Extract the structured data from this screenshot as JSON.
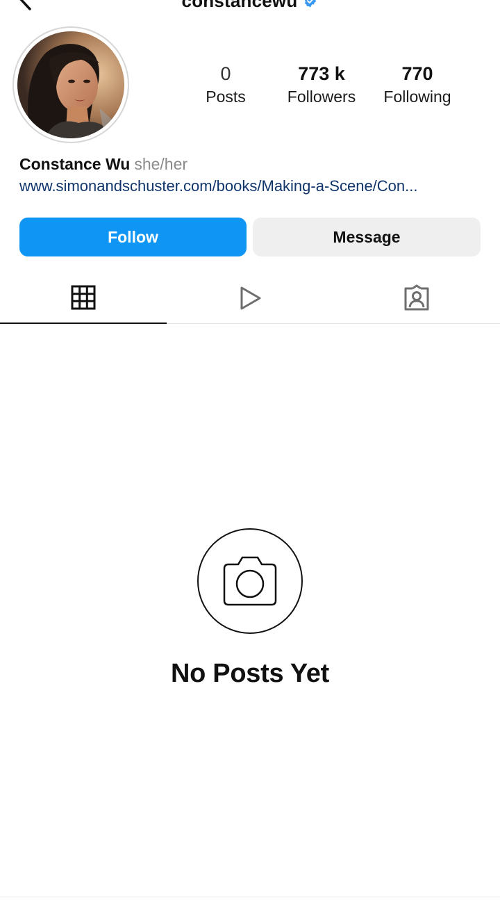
{
  "header": {
    "username": "constancewu",
    "verified": true,
    "back_icon": "chevron-left-icon",
    "more_icon": "more-horizontal-icon"
  },
  "profile": {
    "stats": [
      {
        "value": "0",
        "label": "Posts"
      },
      {
        "value": "773 k",
        "label": "Followers"
      },
      {
        "value": "770",
        "label": "Following"
      }
    ],
    "display_name": "Constance Wu",
    "pronouns": "she/her",
    "website": "www.simonandschuster.com/books/Making-a-Scene/Con..."
  },
  "actions": {
    "follow_label": "Follow",
    "message_label": "Message"
  },
  "tabs": [
    {
      "icon": "grid-icon",
      "active": true
    },
    {
      "icon": "reels-play-icon",
      "active": false
    },
    {
      "icon": "tagged-person-icon",
      "active": false
    }
  ],
  "empty_state": {
    "icon": "camera-icon",
    "title": "No Posts Yet"
  },
  "colors": {
    "follow_button": "#0f95f4",
    "message_button": "#efefef",
    "link": "#10356b",
    "verified_badge": "#3897f0",
    "pronouns": "#8a8a8a"
  }
}
